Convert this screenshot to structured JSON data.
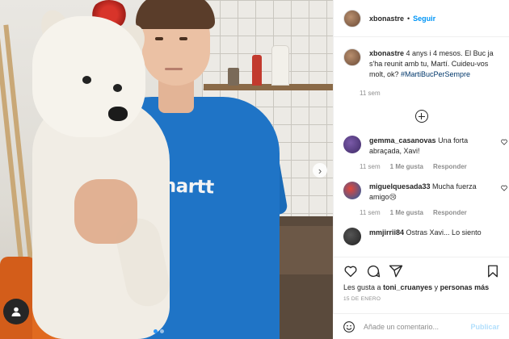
{
  "post": {
    "username": "xbonastre",
    "separator": "•",
    "follow_label": "Seguir",
    "caption_text": "4 anys i 4 mesos. El Buc ja s'ha reunit amb tu, Martí. Cuideu-vos molt, ok?",
    "hashtag": "#MartiBucPerSempre",
    "caption_age": "11 sem",
    "shirt_brand": "arhartt",
    "image_dots": 2,
    "active_dot": 1
  },
  "comments": [
    {
      "username": "gemma_casanovas",
      "text": "Una forta abraçada, Xavi!",
      "age": "11 sem",
      "likes": "1 Me gusta",
      "reply": "Responder"
    },
    {
      "username": "miguelquesada33",
      "text": "Mucha fuerza amigo😢",
      "age": "11 sem",
      "likes": "1 Me gusta",
      "reply": "Responder"
    },
    {
      "username": "mmjirrii84",
      "text": "Ostras Xavi... Lo siento"
    }
  ],
  "likes_summary": {
    "prefix": "Les gusta a",
    "user": "toni_cruanyes",
    "connector": "y",
    "others": "personas más"
  },
  "date": "15 DE ENERO",
  "add_comment": {
    "placeholder": "Añade un comentario...",
    "post_label": "Publicar"
  },
  "icons": {
    "heart": "heart-icon",
    "comment": "comment-icon",
    "share": "share-icon",
    "bookmark": "bookmark-icon",
    "emoji": "emoji-icon",
    "plus": "plus-circle-icon",
    "next": "chevron-right-icon",
    "user": "user-icon"
  },
  "colors": {
    "accent": "#0095f6",
    "hashtag": "#00376b",
    "muted": "#8e8e8e",
    "shirt": "#1f74c6"
  }
}
